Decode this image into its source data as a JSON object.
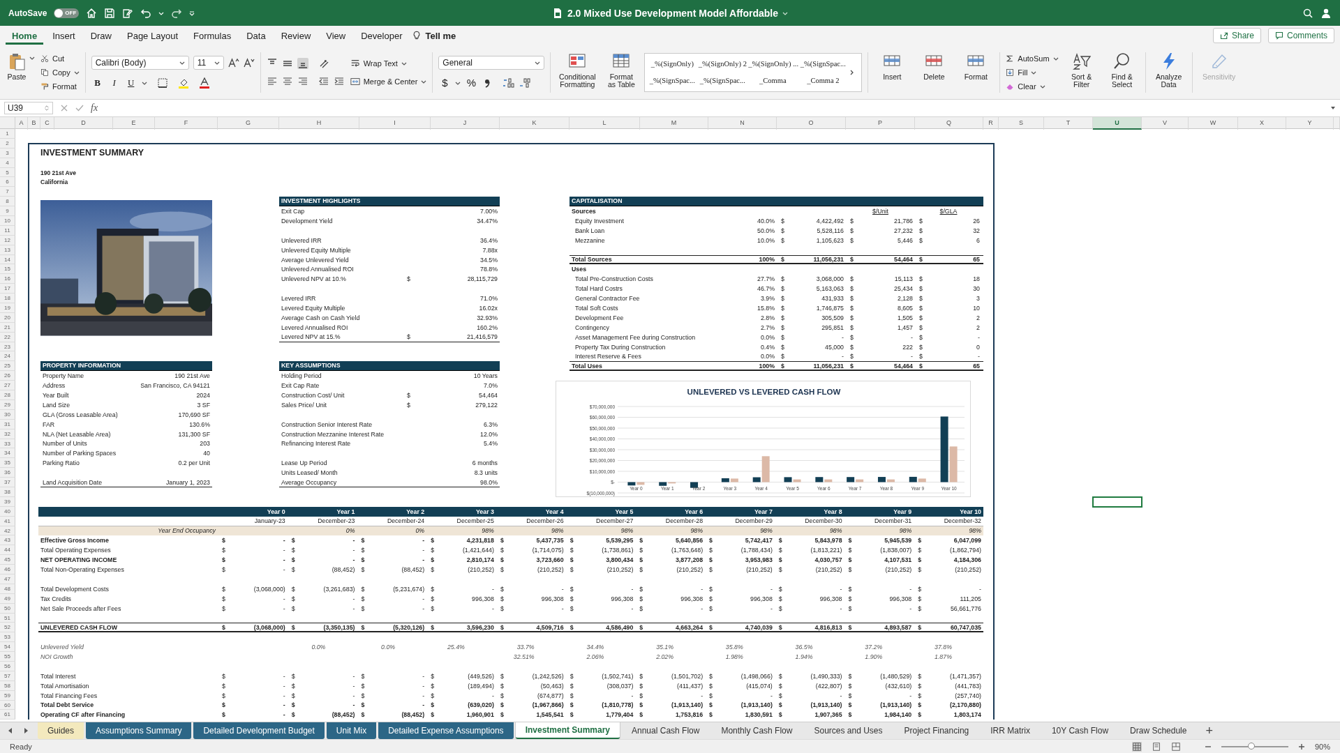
{
  "title_bar": {
    "autosave_label": "AutoSave",
    "autosave": {
      "on": false,
      "label": "OFF"
    },
    "title": "2.0 Mixed Use Development Model Affordable"
  },
  "ribbon_tabs": [
    {
      "label": "Home",
      "selected": true
    },
    {
      "label": "Insert",
      "selected": false
    },
    {
      "label": "Draw",
      "selected": false
    },
    {
      "label": "Page Layout",
      "selected": false
    },
    {
      "label": "Formulas",
      "selected": false
    },
    {
      "label": "Data",
      "selected": false
    },
    {
      "label": "Review",
      "selected": false
    },
    {
      "label": "View",
      "selected": false
    },
    {
      "label": "Developer",
      "selected": false
    }
  ],
  "tell_me": "Tell me",
  "share": "Share",
  "comments": "Comments",
  "ribbon": {
    "paste": "Paste",
    "cut": "Cut",
    "copy": "Copy",
    "format_painter": "Format",
    "font_name": "Calibri (Body)",
    "font_size": "11",
    "bold": "B",
    "italic": "I",
    "underline": "U",
    "wrap_text": "Wrap Text",
    "merge_center": "Merge & Center",
    "number_format": "General",
    "currency": "$",
    "percent": "%",
    "conditional_formatting": "Conditional Formatting",
    "format_as_table": "Format as Table",
    "styles": [
      "_%(SignOnly)",
      "_%(SignOnly) 2",
      "_%(SignOnly) ...",
      "_%(SignSpac...",
      "_%(SignSpac...",
      "_%(SignSpac...",
      "_Comma",
      "_Comma 2"
    ],
    "cells": [
      "Insert",
      "Delete",
      "Format"
    ],
    "autosum": "AutoSum",
    "fill": "Fill",
    "clear": "Clear",
    "sort_filter": "Sort & Filter",
    "find_select": "Find & Select",
    "analyze": "Analyze Data",
    "sensitivity": {
      "label": "Sensitivity",
      "disabled": true
    }
  },
  "formula_bar": {
    "name_box": "U39",
    "fx": "fx"
  },
  "columns": [
    {
      "label": "A",
      "selected": false
    },
    {
      "label": "B",
      "selected": false
    },
    {
      "label": "C",
      "selected": false
    },
    {
      "label": "D",
      "selected": false
    },
    {
      "label": "E",
      "selected": false
    },
    {
      "label": "F",
      "selected": false
    },
    {
      "label": "G",
      "selected": false
    },
    {
      "label": "H",
      "selected": false
    },
    {
      "label": "I",
      "selected": false
    },
    {
      "label": "J",
      "selected": false
    },
    {
      "label": "K",
      "selected": false
    },
    {
      "label": "L",
      "selected": false
    },
    {
      "label": "M",
      "selected": false
    },
    {
      "label": "N",
      "selected": false
    },
    {
      "label": "O",
      "selected": false
    },
    {
      "label": "P",
      "selected": false
    },
    {
      "label": "Q",
      "selected": false
    },
    {
      "label": "R",
      "selected": false
    },
    {
      "label": "S",
      "selected": false
    },
    {
      "label": "T",
      "selected": false
    },
    {
      "label": "U",
      "selected": true
    },
    {
      "label": "V",
      "selected": false
    },
    {
      "label": "W",
      "selected": false
    },
    {
      "label": "X",
      "selected": false
    },
    {
      "label": "Y",
      "selected": false
    }
  ],
  "row_numbers": [
    "1",
    "2",
    "3",
    "4",
    "5",
    "6",
    "7",
    "8",
    "9",
    "10",
    "11",
    "12",
    "13",
    "14",
    "15",
    "16",
    "17",
    "18",
    "19",
    "20",
    "21",
    "22",
    "23",
    "24",
    "25",
    "26",
    "27",
    "28",
    "29",
    "30",
    "31",
    "32",
    "33",
    "34",
    "35",
    "36",
    "37",
    "38",
    "39",
    "40",
    "41",
    "42",
    "43",
    "44",
    "45",
    "46",
    "47",
    "48",
    "49",
    "50",
    "51",
    "52",
    "53",
    "54",
    "55",
    "56",
    "57",
    "58",
    "59",
    "60",
    "61"
  ],
  "summary": {
    "title": "INVESTMENT SUMMARY",
    "address": "190 21st Ave",
    "state": "California",
    "property_info": {
      "heading": "PROPERTY INFORMATION",
      "rows": [
        {
          "kind": "item",
          "label": "Property Name",
          "value": "190 21st Ave"
        },
        {
          "kind": "item",
          "label": "Address",
          "value": "San Francisco, CA 94121"
        },
        {
          "kind": "item",
          "label": "Year Built",
          "value": "2024"
        },
        {
          "kind": "item",
          "label": "Land Size",
          "value": "3 SF"
        },
        {
          "kind": "item",
          "label": "GLA (Gross Leasable Area)",
          "value": "170,690 SF"
        },
        {
          "kind": "item",
          "label": "FAR",
          "value": "130.6%"
        },
        {
          "kind": "item",
          "label": "NLA (Net Leasable Area)",
          "value": "131,300 SF"
        },
        {
          "kind": "item",
          "label": "Number of Units",
          "value": "203"
        },
        {
          "kind": "item",
          "label": "Number of Parking Spaces",
          "value": "40"
        },
        {
          "kind": "item",
          "label": "Parking Ratio",
          "value": "0.2 per Unit"
        },
        {
          "kind": "gap"
        },
        {
          "kind": "item",
          "label": "Land Acquisition Date",
          "value": "January 1, 2023"
        }
      ]
    },
    "highlights": {
      "heading": "INVESTMENT HIGHLIGHTS",
      "rows": [
        {
          "kind": "item",
          "label": "Exit Cap",
          "value": "7.00%"
        },
        {
          "kind": "item",
          "label": "Development Yield",
          "value": "34.47%"
        },
        {
          "kind": "gap"
        },
        {
          "kind": "item",
          "label": "Unlevered IRR",
          "value": "36.4%"
        },
        {
          "kind": "item",
          "label": "Unlevered Equity Multiple",
          "value": "7.88x"
        },
        {
          "kind": "item",
          "label": "Average Unlevered Yield",
          "value": "34.5%"
        },
        {
          "kind": "item",
          "label": "Unlevered Annualised ROI",
          "value": "78.8%"
        },
        {
          "kind": "item",
          "label": "Unlevered NPV at  10.%",
          "cur": "$",
          "value": "28,115,729"
        },
        {
          "kind": "gap"
        },
        {
          "kind": "item",
          "label": "Levered IRR",
          "value": "71.0%"
        },
        {
          "kind": "item",
          "label": "Levered Equity Multiple",
          "value": "16.02x"
        },
        {
          "kind": "item",
          "label": "Average Cash on Cash Yield",
          "value": "32.93%"
        },
        {
          "kind": "item",
          "label": "Levered Annualised ROI",
          "value": "160.2%"
        },
        {
          "kind": "item",
          "label": "Levered NPV at  15.%",
          "cur": "$",
          "value": "21,416,579"
        }
      ]
    },
    "key_assumptions": {
      "heading": "KEY ASSUMPTIONS",
      "rows": [
        {
          "kind": "item",
          "label": "Holding Period",
          "value": "10 Years"
        },
        {
          "kind": "item",
          "label": "Exit Cap Rate",
          "value": "7.0%"
        },
        {
          "kind": "item",
          "label": "Construction Cost/ Unit",
          "cur": "$",
          "value": "54,464"
        },
        {
          "kind": "item",
          "label": "Sales Price/ Unit",
          "cur": "$",
          "value": "279,122"
        },
        {
          "kind": "gap"
        },
        {
          "kind": "item",
          "label": "Construction Senior Interest Rate",
          "value": "6.3%"
        },
        {
          "kind": "item",
          "label": "Construction Mezzanine Interest Rate",
          "value": "12.0%"
        },
        {
          "kind": "item",
          "label": "Refinancing Interest Rate",
          "value": "5.4%"
        },
        {
          "kind": "gap"
        },
        {
          "kind": "item",
          "label": "Lease Up Period",
          "value": "6 months"
        },
        {
          "kind": "item",
          "label": "Units Leased/ Month",
          "value": "8.3 units"
        },
        {
          "kind": "item",
          "label": "Average Occupancy",
          "value": "98.0%"
        }
      ]
    },
    "capitalisation": {
      "heading": "CAPITALISATION",
      "rows": [
        {
          "kind": "head",
          "label": "Sources",
          "unit": "$/Unit",
          "gla": "$/GLA"
        },
        {
          "kind": "item",
          "label": "Equity Investment",
          "pct": "40.0%",
          "c1": "$",
          "amount": "4,422,492",
          "c2": "$",
          "per_unit": "21,786",
          "c3": "$",
          "per_gla": "26"
        },
        {
          "kind": "item",
          "label": "Bank Loan",
          "pct": "50.0%",
          "c1": "$",
          "amount": "5,528,116",
          "c2": "$",
          "per_unit": "27,232",
          "c3": "$",
          "per_gla": "32"
        },
        {
          "kind": "item",
          "label": "Mezzanine",
          "pct": "10.0%",
          "c1": "$",
          "amount": "1,105,623",
          "c2": "$",
          "per_unit": "5,446",
          "c3": "$",
          "per_gla": "6"
        },
        {
          "kind": "gap"
        },
        {
          "kind": "total",
          "label": "Total Sources",
          "pct": "100%",
          "c1": "$",
          "amount": "11,056,231",
          "c2": "$",
          "per_unit": "54,464",
          "c3": "$",
          "per_gla": "65"
        },
        {
          "kind": "head",
          "label": "Uses"
        },
        {
          "kind": "item",
          "label": "Total Pre-Construction Costs",
          "pct": "27.7%",
          "c1": "$",
          "amount": "3,068,000",
          "c2": "$",
          "per_unit": "15,113",
          "c3": "$",
          "per_gla": "18"
        },
        {
          "kind": "item",
          "label": "Total Hard Costrs",
          "pct": "46.7%",
          "c1": "$",
          "amount": "5,163,063",
          "c2": "$",
          "per_unit": "25,434",
          "c3": "$",
          "per_gla": "30"
        },
        {
          "kind": "item",
          "label": "General Contractor Fee",
          "pct": "3.9%",
          "c1": "$",
          "amount": "431,933",
          "c2": "$",
          "per_unit": "2,128",
          "c3": "$",
          "per_gla": "3"
        },
        {
          "kind": "item",
          "label": "Total Soft Costs",
          "pct": "15.8%",
          "c1": "$",
          "amount": "1,746,875",
          "c2": "$",
          "per_unit": "8,605",
          "c3": "$",
          "per_gla": "10"
        },
        {
          "kind": "item",
          "label": "Development Fee",
          "pct": "2.8%",
          "c1": "$",
          "amount": "305,509",
          "c2": "$",
          "per_unit": "1,505",
          "c3": "$",
          "per_gla": "2"
        },
        {
          "kind": "item",
          "label": "Contingency",
          "pct": "2.7%",
          "c1": "$",
          "amount": "295,851",
          "c2": "$",
          "per_unit": "1,457",
          "c3": "$",
          "per_gla": "2"
        },
        {
          "kind": "item",
          "label": "Asset Management Fee during Construction",
          "pct": "0.0%",
          "c1": "$",
          "amount": "-",
          "c2": "$",
          "per_unit": "-",
          "c3": "$",
          "per_gla": "-"
        },
        {
          "kind": "item",
          "label": "Property Tax During Construction",
          "pct": "0.4%",
          "c1": "$",
          "amount": "45,000",
          "c2": "$",
          "per_unit": "222",
          "c3": "$",
          "per_gla": "0"
        },
        {
          "kind": "item",
          "label": "Interest Reserve & Fees",
          "pct": "0.0%",
          "c1": "$",
          "amount": "-",
          "c2": "$",
          "per_unit": "-",
          "c3": "$",
          "per_gla": "-"
        },
        {
          "kind": "total",
          "label": "Total Uses",
          "pct": "100%",
          "c1": "$",
          "amount": "11,056,231",
          "c2": "$",
          "per_unit": "54,464",
          "c3": "$",
          "per_gla": "65"
        }
      ]
    },
    "chart": {
      "chart_data": {
        "type": "bar",
        "title": "UNLEVERED VS LEVERED CASH FLOW",
        "categories": [
          "Year 0",
          "Year 1",
          "Year 2",
          "Year 3",
          "Year 4",
          "Year 5",
          "Year 6",
          "Year 7",
          "Year 8",
          "Year 9",
          "Year 10"
        ],
        "series": [
          {
            "color": "#123f55",
            "values": [
              -3100000,
              -3400000,
              -5300000,
              3600000,
              4500000,
              4600000,
              4700000,
              4700000,
              4800000,
              4900000,
              60700000
            ]
          },
          {
            "color": "#dcb9a7",
            "values": [
              -2500000,
              -1200000,
              0,
              3300000,
              24000000,
              2500000,
              2500000,
              2500000,
              2500000,
              3300000,
              33000000
            ]
          }
        ],
        "ylim": [
          -10000000,
          70000000
        ],
        "grid": true,
        "yticks": [
          {
            "value": -10000000,
            "label": "$(10,000,000)"
          },
          {
            "value": 0,
            "label": "$-"
          },
          {
            "value": 10000000,
            "label": "$10,000,000"
          },
          {
            "value": 20000000,
            "label": "$20,000,000"
          },
          {
            "value": 30000000,
            "label": "$30,000,000"
          },
          {
            "value": 40000000,
            "label": "$40,000,000"
          },
          {
            "value": 50000000,
            "label": "$50,000,000"
          },
          {
            "value": 60000000,
            "label": "$60,000,000"
          },
          {
            "value": 70000000,
            "label": "$70,000,000"
          }
        ]
      }
    },
    "cash_flow": {
      "years": [
        "Year 0",
        "Year 1",
        "Year 2",
        "Year 3",
        "Year 4",
        "Year 5",
        "Year 6",
        "Year 7",
        "Year 8",
        "Year 9",
        "Year 10"
      ],
      "dates": [
        "January-23",
        "December-23",
        "December-24",
        "December-25",
        "December-26",
        "December-27",
        "December-28",
        "December-29",
        "December-30",
        "December-31",
        "December-32"
      ],
      "occupancy_label": "Year End Occupancy",
      "occupancy": [
        {
          "kind": "blank"
        },
        {
          "kind": "value",
          "text": "0%"
        },
        {
          "kind": "value",
          "text": "0%"
        },
        {
          "kind": "value",
          "text": "98%"
        },
        {
          "kind": "value",
          "text": "98%"
        },
        {
          "kind": "value",
          "text": "98%"
        },
        {
          "kind": "value",
          "text": "98%"
        },
        {
          "kind": "value",
          "text": "98%"
        },
        {
          "kind": "value",
          "text": "98%"
        },
        {
          "kind": "value",
          "text": "98%"
        },
        {
          "kind": "value",
          "text": "98%"
        }
      ],
      "rows": [
        {
          "kind": "bold",
          "label": "Effective Gross Income",
          "cells": [
            [
              "$",
              "-"
            ],
            [
              "$",
              "-"
            ],
            [
              "$",
              "-"
            ],
            [
              "$",
              "4,231,818"
            ],
            [
              "$",
              "5,437,735"
            ],
            [
              "$",
              "5,539,295"
            ],
            [
              "$",
              "5,640,856"
            ],
            [
              "$",
              "5,742,417"
            ],
            [
              "$",
              "5,843,978"
            ],
            [
              "$",
              "5,945,539"
            ],
            [
              "$",
              "6,047,099"
            ]
          ]
        },
        {
          "kind": "plain",
          "label": "Total Operating Expenses",
          "cells": [
            [
              "$",
              "-"
            ],
            [
              "$",
              "-"
            ],
            [
              "$",
              "-"
            ],
            [
              "$",
              "(1,421,644)"
            ],
            [
              "$",
              "(1,714,075)"
            ],
            [
              "$",
              "(1,738,861)"
            ],
            [
              "$",
              "(1,763,648)"
            ],
            [
              "$",
              "(1,788,434)"
            ],
            [
              "$",
              "(1,813,221)"
            ],
            [
              "$",
              "(1,838,007)"
            ],
            [
              "$",
              "(1,862,794)"
            ]
          ]
        },
        {
          "kind": "bold",
          "label": "NET OPERATING INCOME",
          "cells": [
            [
              "$",
              "-"
            ],
            [
              "$",
              "-"
            ],
            [
              "$",
              "-"
            ],
            [
              "$",
              "2,810,174"
            ],
            [
              "$",
              "3,723,660"
            ],
            [
              "$",
              "3,800,434"
            ],
            [
              "$",
              "3,877,208"
            ],
            [
              "$",
              "3,953,983"
            ],
            [
              "$",
              "4,030,757"
            ],
            [
              "$",
              "4,107,531"
            ],
            [
              "$",
              "4,184,306"
            ]
          ]
        },
        {
          "kind": "plain",
          "label": "Total Non-Operating Expenses",
          "cells": [
            [
              "$",
              "-"
            ],
            [
              "$",
              "(88,452)"
            ],
            [
              "$",
              "(88,452)"
            ],
            [
              "$",
              "(210,252)"
            ],
            [
              "$",
              "(210,252)"
            ],
            [
              "$",
              "(210,252)"
            ],
            [
              "$",
              "(210,252)"
            ],
            [
              "$",
              "(210,252)"
            ],
            [
              "$",
              "(210,252)"
            ],
            [
              "$",
              "(210,252)"
            ],
            [
              "$",
              "(210,252)"
            ]
          ]
        },
        {
          "kind": "gap"
        },
        {
          "kind": "plain",
          "label": "Total Development Costs",
          "cells": [
            [
              "$",
              "(3,068,000)"
            ],
            [
              "$",
              "(3,261,683)"
            ],
            [
              "$",
              "(5,231,674)"
            ],
            [
              "$",
              "-"
            ],
            [
              "$",
              "-"
            ],
            [
              "$",
              "-"
            ],
            [
              "$",
              "-"
            ],
            [
              "$",
              "-"
            ],
            [
              "$",
              "-"
            ],
            [
              "$",
              "-"
            ],
            [
              "$",
              "-"
            ]
          ]
        },
        {
          "kind": "plain",
          "label": "Tax Credits",
          "cells": [
            [
              "$",
              "-"
            ],
            [
              "$",
              "-"
            ],
            [
              "$",
              "-"
            ],
            [
              "$",
              "996,308"
            ],
            [
              "$",
              "996,308"
            ],
            [
              "$",
              "996,308"
            ],
            [
              "$",
              "996,308"
            ],
            [
              "$",
              "996,308"
            ],
            [
              "$",
              "996,308"
            ],
            [
              "$",
              "996,308"
            ],
            [
              "$",
              "111,205"
            ]
          ]
        },
        {
          "kind": "plain",
          "label": "Net Sale Proceeds after Fees",
          "cells": [
            [
              "$",
              "-"
            ],
            [
              "$",
              "-"
            ],
            [
              "$",
              "-"
            ],
            [
              "$",
              "-"
            ],
            [
              "$",
              "-"
            ],
            [
              "$",
              "-"
            ],
            [
              "$",
              "-"
            ],
            [
              "$",
              "-"
            ],
            [
              "$",
              "-"
            ],
            [
              "$",
              "-"
            ],
            [
              "$",
              "56,661,776"
            ]
          ]
        },
        {
          "kind": "gap"
        },
        {
          "kind": "total",
          "label": "UNLEVERED CASH FLOW",
          "cells": [
            [
              "$",
              "(3,068,000)"
            ],
            [
              "$",
              "(3,350,135)"
            ],
            [
              "$",
              "(5,320,126)"
            ],
            [
              "$",
              "3,596,230"
            ],
            [
              "$",
              "4,509,716"
            ],
            [
              "$",
              "4,586,490"
            ],
            [
              "$",
              "4,663,264"
            ],
            [
              "$",
              "4,740,039"
            ],
            [
              "$",
              "4,816,813"
            ],
            [
              "$",
              "4,893,587"
            ],
            [
              "$",
              "60,747,035"
            ]
          ]
        },
        {
          "kind": "gap"
        },
        {
          "kind": "ratio",
          "label": "Unlevered Yield",
          "values": [
            {
              "kind": "blank"
            },
            {
              "kind": "value",
              "text": "0.0%"
            },
            {
              "kind": "value",
              "text": "0.0%"
            },
            {
              "kind": "value",
              "text": "25.4%"
            },
            {
              "kind": "value",
              "text": "33.7%"
            },
            {
              "kind": "value",
              "text": "34.4%"
            },
            {
              "kind": "value",
              "text": "35.1%"
            },
            {
              "kind": "value",
              "text": "35.8%"
            },
            {
              "kind": "value",
              "text": "36.5%"
            },
            {
              "kind": "value",
              "text": "37.2%"
            },
            {
              "kind": "value",
              "text": "37.8%"
            }
          ]
        },
        {
          "kind": "ratio",
          "label": "NOI Growth",
          "values": [
            {
              "kind": "blank"
            },
            {
              "kind": "blank"
            },
            {
              "kind": "blank"
            },
            {
              "kind": "blank"
            },
            {
              "kind": "value",
              "text": "32.51%"
            },
            {
              "kind": "value",
              "text": "2.06%"
            },
            {
              "kind": "value",
              "text": "2.02%"
            },
            {
              "kind": "value",
              "text": "1.98%"
            },
            {
              "kind": "value",
              "text": "1.94%"
            },
            {
              "kind": "value",
              "text": "1.90%"
            },
            {
              "kind": "value",
              "text": "1.87%"
            }
          ]
        },
        {
          "kind": "gap"
        },
        {
          "kind": "plain",
          "label": "Total Interest",
          "cells": [
            [
              "$",
              "-"
            ],
            [
              "$",
              "-"
            ],
            [
              "$",
              "-"
            ],
            [
              "$",
              "(449,526)"
            ],
            [
              "$",
              "(1,242,526)"
            ],
            [
              "$",
              "(1,502,741)"
            ],
            [
              "$",
              "(1,501,702)"
            ],
            [
              "$",
              "(1,498,066)"
            ],
            [
              "$",
              "(1,490,333)"
            ],
            [
              "$",
              "(1,480,529)"
            ],
            [
              "$",
              "(1,471,357)"
            ]
          ]
        },
        {
          "kind": "plain",
          "label": "Total Amortisation",
          "cells": [
            [
              "$",
              "-"
            ],
            [
              "$",
              "-"
            ],
            [
              "$",
              "-"
            ],
            [
              "$",
              "(189,494)"
            ],
            [
              "$",
              "(50,463)"
            ],
            [
              "$",
              "(308,037)"
            ],
            [
              "$",
              "(411,437)"
            ],
            [
              "$",
              "(415,074)"
            ],
            [
              "$",
              "(422,807)"
            ],
            [
              "$",
              "(432,610)"
            ],
            [
              "$",
              "(441,783)"
            ]
          ]
        },
        {
          "kind": "plain",
          "label": "Total Financing Fees",
          "cells": [
            [
              "$",
              "-"
            ],
            [
              "$",
              "-"
            ],
            [
              "$",
              "-"
            ],
            [
              "$",
              "-"
            ],
            [
              "$",
              "(674,877)"
            ],
            [
              "$",
              "-"
            ],
            [
              "$",
              "-"
            ],
            [
              "$",
              "-"
            ],
            [
              "$",
              "-"
            ],
            [
              "$",
              "-"
            ],
            [
              "$",
              "(257,740)"
            ]
          ]
        },
        {
          "kind": "bold",
          "label": "Total Debt Service",
          "cells": [
            [
              "$",
              "-"
            ],
            [
              "$",
              "-"
            ],
            [
              "$",
              "-"
            ],
            [
              "$",
              "(639,020)"
            ],
            [
              "$",
              "(1,967,866)"
            ],
            [
              "$",
              "(1,810,778)"
            ],
            [
              "$",
              "(1,913,140)"
            ],
            [
              "$",
              "(1,913,140)"
            ],
            [
              "$",
              "(1,913,140)"
            ],
            [
              "$",
              "(1,913,140)"
            ],
            [
              "$",
              "(2,170,880)"
            ]
          ]
        },
        {
          "kind": "bold",
          "label": "Operating CF after Financing",
          "cells": [
            [
              "$",
              "-"
            ],
            [
              "$",
              "(88,452)"
            ],
            [
              "$",
              "(88,452)"
            ],
            [
              "$",
              "1,960,901"
            ],
            [
              "$",
              "1,545,541"
            ],
            [
              "$",
              "1,779,404"
            ],
            [
              "$",
              "1,753,816"
            ],
            [
              "$",
              "1,830,591"
            ],
            [
              "$",
              "1,907,365"
            ],
            [
              "$",
              "1,984,140"
            ],
            [
              "$",
              "1,803,174"
            ]
          ]
        }
      ]
    }
  },
  "sheet_tabs": [
    {
      "label": "Guides",
      "selected": false,
      "color": "#f3e9bd"
    },
    {
      "label": "Assumptions Summary",
      "selected": false,
      "color": "#2c6686"
    },
    {
      "label": "Detailed Development Budget",
      "selected": false,
      "color": "#2c6686"
    },
    {
      "label": "Unit Mix",
      "selected": false,
      "color": "#2c6686"
    },
    {
      "label": "Detailed Expense Assumptions",
      "selected": false,
      "color": "#2c6686"
    },
    {
      "label": "Investment Summary",
      "selected": true
    },
    {
      "label": "Annual Cash Flow",
      "selected": false
    },
    {
      "label": "Monthly Cash Flow",
      "selected": false
    },
    {
      "label": "Sources and Uses",
      "selected": false
    },
    {
      "label": "Project Financing",
      "selected": false
    },
    {
      "label": "IRR Matrix",
      "selected": false
    },
    {
      "label": "10Y Cash Flow",
      "selected": false
    },
    {
      "label": "Draw Schedule",
      "selected": false
    }
  ],
  "add_sheet": "+",
  "status_bar": {
    "status": "Ready",
    "zoom": "90%",
    "zoom_slider": {
      "level": 0.45
    }
  }
}
